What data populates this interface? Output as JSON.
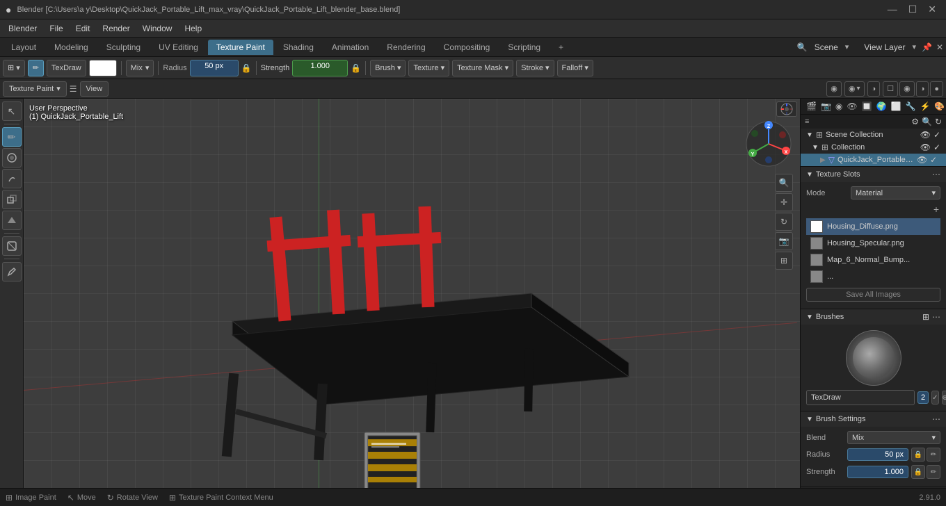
{
  "titlebar": {
    "title": "Blender [C:\\Users\\a y\\Desktop\\QuickJack_Portable_Lift_max_vray\\QuickJack_Portable_Lift_blender_base.blend]",
    "minimize": "—",
    "maximize": "☐",
    "close": "✕"
  },
  "menubar": {
    "items": [
      "Blender",
      "File",
      "Edit",
      "Render",
      "Window",
      "Help"
    ]
  },
  "workspace_tabs": {
    "tabs": [
      "Layout",
      "Modeling",
      "Sculpting",
      "UV Editing",
      "Texture Paint",
      "Shading",
      "Animation",
      "Rendering",
      "Compositing",
      "Scripting"
    ],
    "active": "Texture Paint",
    "add_icon": "+",
    "scene_label": "Scene",
    "view_layer_label": "View Layer"
  },
  "toolbar": {
    "mode_icon": "⊞",
    "brush_icon": "✏",
    "tex_draw_label": "TexDraw",
    "color_value": "#ffffff",
    "blend_label": "Mix",
    "radius_label": "Radius",
    "radius_value": "50 px",
    "radius_icon": "🔒",
    "strength_label": "Strength",
    "strength_value": "1.000",
    "strength_icon": "🔒",
    "brush_btn": "Brush ▾",
    "texture_btn": "Texture ▾",
    "texture_mask_btn": "Texture Mask ▾",
    "stroke_btn": "Stroke ▾",
    "falloff_btn": "Falloff ▾"
  },
  "subbar": {
    "texture_paint_label": "Texture Paint",
    "view_label": "View",
    "overlay_icons": [
      "⊕",
      "⊙",
      "☰",
      "◉"
    ]
  },
  "left_tools": {
    "tools": [
      {
        "icon": "↖",
        "name": "select",
        "active": false
      },
      {
        "icon": "✏",
        "name": "draw",
        "active": true
      },
      {
        "icon": "◐",
        "name": "soften",
        "active": false
      },
      {
        "icon": "◈",
        "name": "smear",
        "active": false
      },
      {
        "icon": "⬡",
        "name": "clone",
        "active": false
      },
      {
        "icon": "⬢",
        "name": "fill",
        "active": false
      },
      {
        "icon": "◫",
        "name": "mask",
        "active": false
      },
      {
        "icon": "✂",
        "name": "annotate",
        "active": false
      }
    ]
  },
  "viewport": {
    "info_line1": "User Perspective",
    "info_line2": "(1) QuickJack_Portable_Lift"
  },
  "nav_buttons": [
    "🔍",
    "⊕",
    "↕",
    "🎦",
    "⊞"
  ],
  "outliner": {
    "search_placeholder": "🔍",
    "scene_collection": "Scene Collection",
    "collection": "Collection",
    "object_name": "QuickJack_Portable_..."
  },
  "right_panel_icons": [
    "🎬",
    "⊕",
    "◉",
    "📐",
    "🎭",
    "🎨",
    "⚡",
    "🔧",
    "🌍",
    "📷",
    "🔲"
  ],
  "texture_slots": {
    "header": "Texture Slots",
    "mode_label": "Mode",
    "mode_value": "Material",
    "items": [
      {
        "name": "Housing_Diffuse.png",
        "selected": true,
        "thumb": "white"
      },
      {
        "name": "Housing_Specular.png",
        "selected": false,
        "thumb": "grey"
      },
      {
        "name": "Map_6_Normal_Bump...",
        "selected": false,
        "thumb": "grey"
      },
      {
        "name": "...",
        "selected": false,
        "thumb": "grey"
      }
    ],
    "add_icon": "+",
    "save_all_label": "Save All Images"
  },
  "brushes": {
    "header": "Brushes",
    "name": "TexDraw",
    "number": "2"
  },
  "brush_settings": {
    "header": "Brush Settings",
    "blend_label": "Blend",
    "blend_value": "Mix",
    "radius_label": "Radius",
    "radius_value": "50 px",
    "strength_label": "Strength",
    "strength_value": "1.000"
  },
  "statusbar": {
    "image_paint": "Image Paint",
    "move": "Move",
    "rotate": "Rotate View",
    "texture_paint_context": "Texture Paint Context Menu",
    "version": "2.91.0"
  }
}
